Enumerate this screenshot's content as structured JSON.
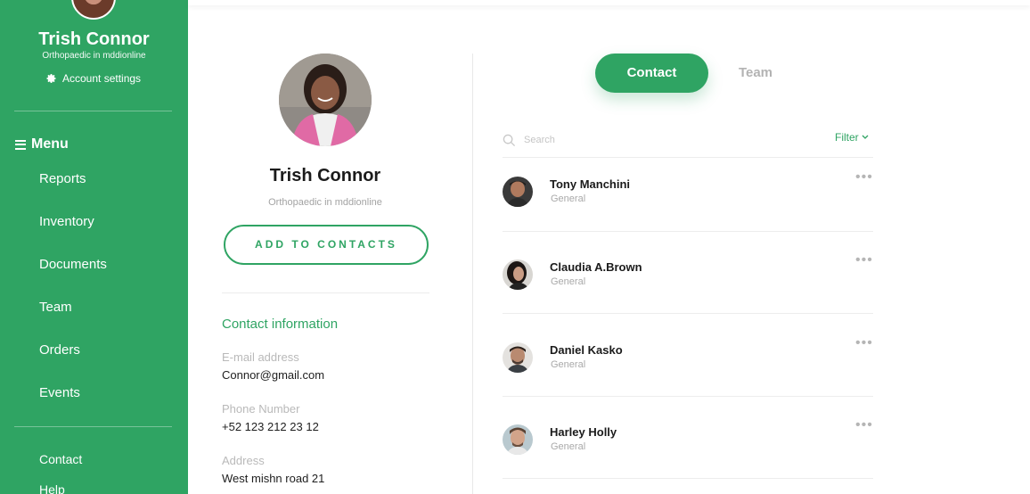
{
  "sidebar": {
    "user_name": "Trish Connor",
    "user_role": "Orthopaedic in mddionline",
    "account_settings": "Account settings",
    "menu_title": "Menu",
    "items": [
      {
        "label": "Reports"
      },
      {
        "label": "Inventory"
      },
      {
        "label": "Documents"
      },
      {
        "label": "Team"
      },
      {
        "label": "Orders"
      },
      {
        "label": "Events"
      }
    ],
    "footer_items": [
      {
        "label": "Contact"
      },
      {
        "label": "Help"
      }
    ],
    "bg_color": "#2fa463"
  },
  "profile": {
    "name": "Trish Connor",
    "role": "Orthopaedic in mddionline",
    "add_button": "ADD TO CONTACTS",
    "contact_info_title": "Contact information",
    "email_label": "E-mail address",
    "email_value": "Connor@gmail.com",
    "phone_label": "Phone Number",
    "phone_value": "+52 123 212 23 12",
    "address_label": "Address",
    "address_value": "West mishn road 21"
  },
  "tabs": {
    "contact": "Contact",
    "team": "Team",
    "active": "Contact"
  },
  "search": {
    "placeholder": "Search"
  },
  "filter_label": "Filter",
  "contacts": [
    {
      "name": "Tony Manchini",
      "group": "General"
    },
    {
      "name": "Claudia A.Brown",
      "group": "General"
    },
    {
      "name": "Daniel Kasko",
      "group": "General"
    },
    {
      "name": "Harley Holly",
      "group": "General"
    }
  ],
  "more_glyph": "•••",
  "accent_color": "#2fa463"
}
